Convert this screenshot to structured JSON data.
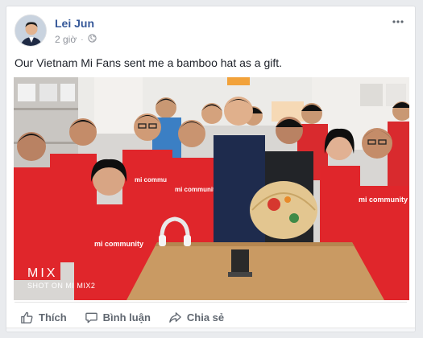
{
  "post": {
    "author": "Lei Jun",
    "timestamp": "2 giờ",
    "privacy_icon": "globe-icon",
    "text": "Our Vietnam Mi Fans sent me a bamboo hat as a gift.",
    "more_icon": "ellipsis-icon"
  },
  "photo": {
    "watermark_brand": "MIX",
    "watermark_caption": "SHOT ON MI MIX2",
    "shirt_text": "mi community"
  },
  "actions": {
    "like": "Thích",
    "comment": "Bình luận",
    "share": "Chia sẻ"
  },
  "colors": {
    "author_link": "#365899",
    "meta_gray": "#90949c",
    "action_gray": "#606770",
    "shirt_red": "#e0262b"
  }
}
